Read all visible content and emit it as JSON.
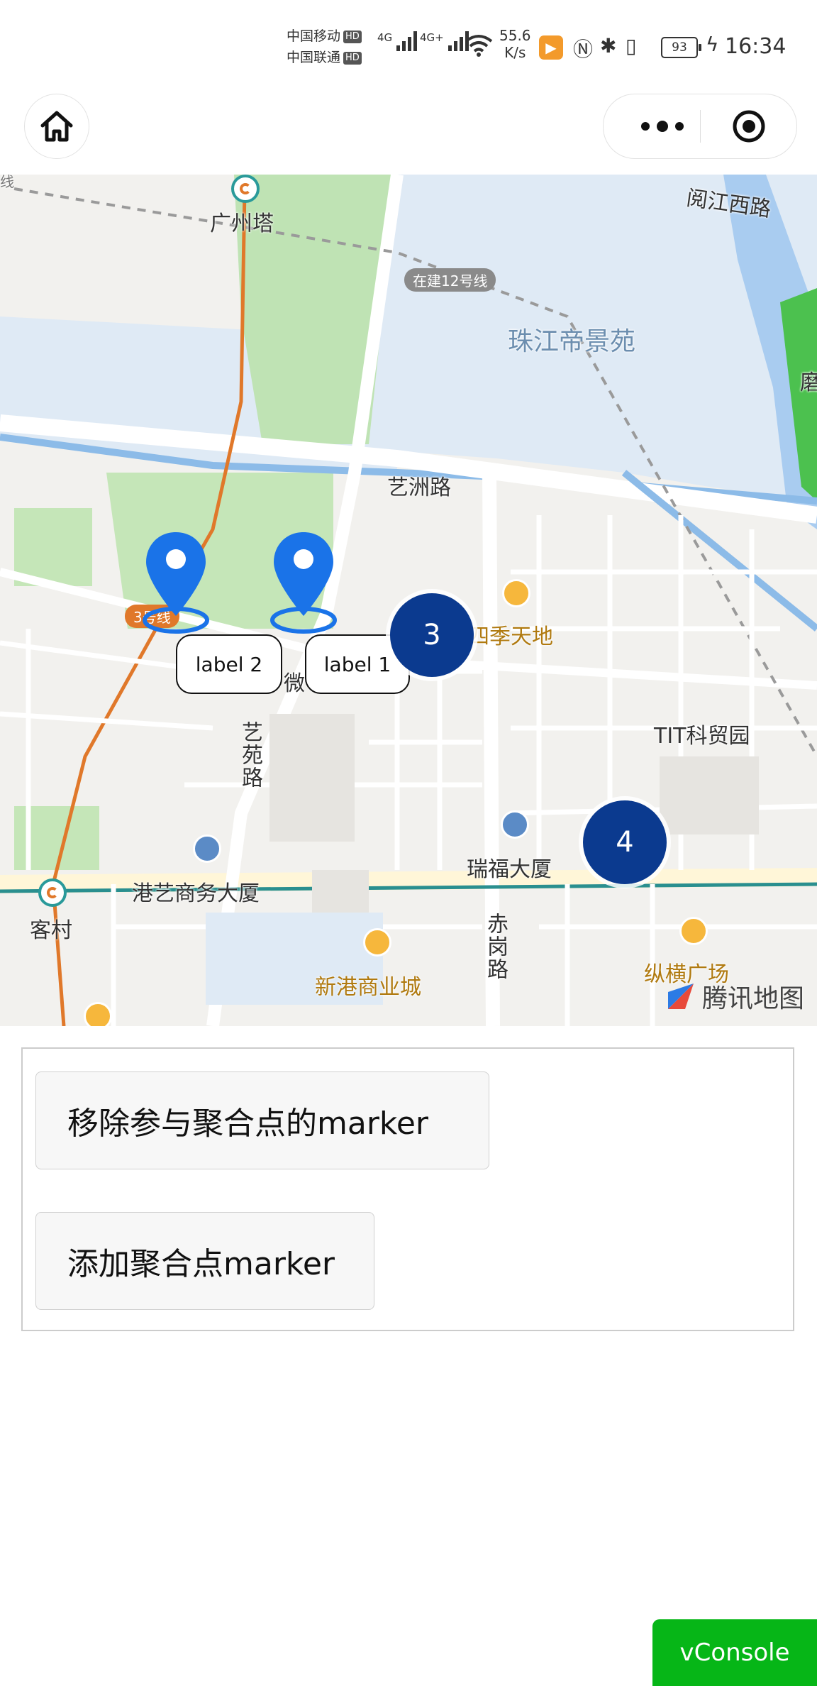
{
  "status_bar": {
    "carrier_1": "中国移动",
    "carrier_2": "中国联通",
    "hd_label": "HD",
    "network_1": "4G",
    "network_2": "4G+",
    "speed_value": "55.6",
    "speed_unit": "K/s",
    "battery": "93",
    "time": "16:34"
  },
  "map": {
    "labels": {
      "guangzhou_tower": "广州塔",
      "yuejiang_west_rd": "阅江西路",
      "line12_building": "在建12号线",
      "zhujiang_dijingyuan": "珠江帝景苑",
      "mo": "磨",
      "yizhou_rd": "艺洲路",
      "four_seasons": "四季天地",
      "line3": "3号线",
      "wei": "微",
      "yiyuan_rd": "艺苑路",
      "tit_park": "TIT科贸园",
      "ruifu_building": "瑞福大厦",
      "gangyi_business": "港艺商务大厦",
      "kecun": "客村",
      "chigang_rd": "赤岗路",
      "xingang_mall": "新港商业城",
      "zongheng_plaza": "纵横广场",
      "line_edge": "线"
    },
    "markers": [
      {
        "label": "label 2"
      },
      {
        "label": "label 1"
      }
    ],
    "clusters": [
      {
        "count": "3"
      },
      {
        "count": "4"
      }
    ],
    "logo_text": "腾讯地图"
  },
  "buttons": {
    "remove_label": "移除参与聚合点的marker",
    "add_label": "添加聚合点marker"
  },
  "vconsole_label": "vConsole",
  "colors": {
    "cluster": "#0b3a8f",
    "marker": "#1a73e8",
    "vconsole": "#06b617",
    "water": "#dfeaf5"
  }
}
